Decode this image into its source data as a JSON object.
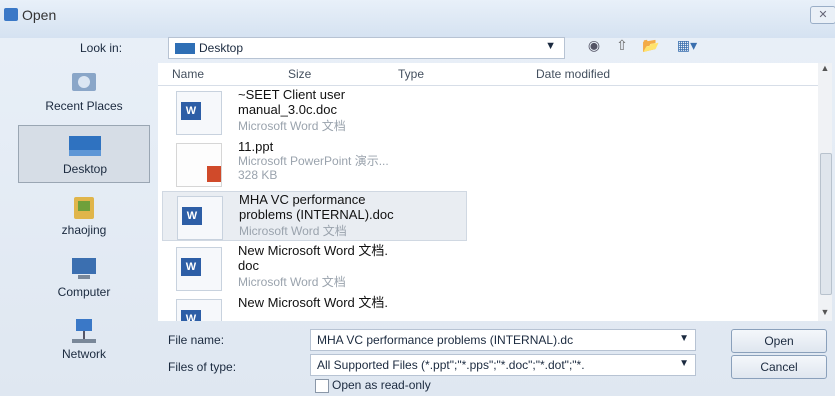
{
  "window": {
    "title": "Open",
    "close": "✕"
  },
  "lookin": {
    "label": "Look in:",
    "value": "Desktop",
    "arrow": "▼"
  },
  "toolbar": {
    "back": "◉",
    "up": "⇧",
    "newfolder": "📂",
    "views": "▦▾"
  },
  "places": [
    {
      "label": "Recent Places"
    },
    {
      "label": "Desktop"
    },
    {
      "label": "zhaojing"
    },
    {
      "label": "Computer"
    },
    {
      "label": "Network"
    }
  ],
  "columns": {
    "name": "Name",
    "size": "Size",
    "type": "Type",
    "date": "Date modified"
  },
  "files": [
    {
      "line1": "~SEET Client user",
      "line2": "manual_3.0c.doc",
      "meta": "Microsoft Word 文档",
      "meta2": ""
    },
    {
      "line1": "11.ppt",
      "line2": "",
      "meta": "Microsoft PowerPoint 演示...",
      "meta2": "328 KB"
    },
    {
      "line1": "MHA VC performance",
      "line2": "problems (INTERNAL).doc",
      "meta": "Microsoft Word 文档",
      "meta2": ""
    },
    {
      "line1": "New Microsoft Word 文档.",
      "line2": "doc",
      "meta": "Microsoft Word 文档",
      "meta2": ""
    },
    {
      "line1": "New Microsoft Word 文档.",
      "line2": "",
      "meta": "",
      "meta2": ""
    }
  ],
  "filename": {
    "label": "File name:",
    "value": "MHA VC performance problems (INTERNAL).dc",
    "arrow": "▼"
  },
  "filetype": {
    "label": "Files of type:",
    "value": "All Supported Files (*.ppt\";\"*.pps\";\"*.doc\";\"*.dot\";\"*.",
    "arrow": "▼"
  },
  "readonly": {
    "label": "Open as read-only"
  },
  "buttons": {
    "open": "Open",
    "cancel": "Cancel"
  },
  "scroll": {
    "up": "▲",
    "down": "▼"
  }
}
